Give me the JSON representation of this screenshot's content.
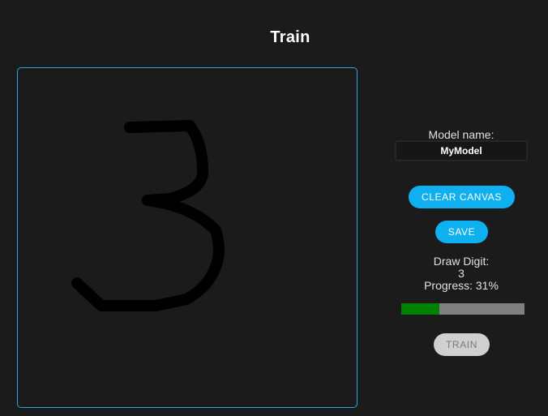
{
  "page": {
    "title": "Train"
  },
  "canvas": {
    "drawn_digit_shape": "3"
  },
  "panel": {
    "model_label": "Model name:",
    "model_value": "MyModel",
    "clear_button_label": "CLEAR CANVAS",
    "save_button_label": "SAVE",
    "draw_digit_label": "Draw Digit:",
    "draw_digit_value": "3",
    "progress_text": "Progress: 31%",
    "progress_value": 0.31,
    "train_button_label": "TRAIN"
  },
  "colors": {
    "accent": "#0fb0f0",
    "canvas_border": "#2fa6e0",
    "progress_fill": "#008000",
    "progress_track": "#808080",
    "disabled_button": "#d0d0d0",
    "background": "#1b1b1b"
  }
}
